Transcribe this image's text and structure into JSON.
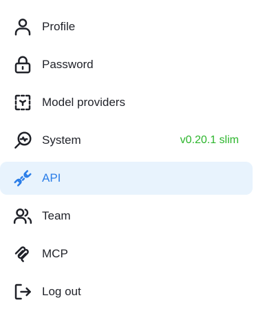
{
  "menu": {
    "items": [
      {
        "label": "Profile",
        "icon": "user-icon"
      },
      {
        "label": "Password",
        "icon": "lock-icon"
      },
      {
        "label": "Model providers",
        "icon": "model-box-icon"
      },
      {
        "label": "System",
        "icon": "system-pulse-icon",
        "version": "v0.20.1 slim"
      },
      {
        "label": "API",
        "icon": "plug-icon",
        "active": true
      },
      {
        "label": "Team",
        "icon": "team-icon"
      },
      {
        "label": "MCP",
        "icon": "mcp-icon"
      },
      {
        "label": "Log out",
        "icon": "logout-icon"
      }
    ]
  },
  "colors": {
    "text": "#1f2128",
    "active_text": "#2a7de8",
    "active_background": "#e8f3fd",
    "version_text": "#2bb52b"
  }
}
